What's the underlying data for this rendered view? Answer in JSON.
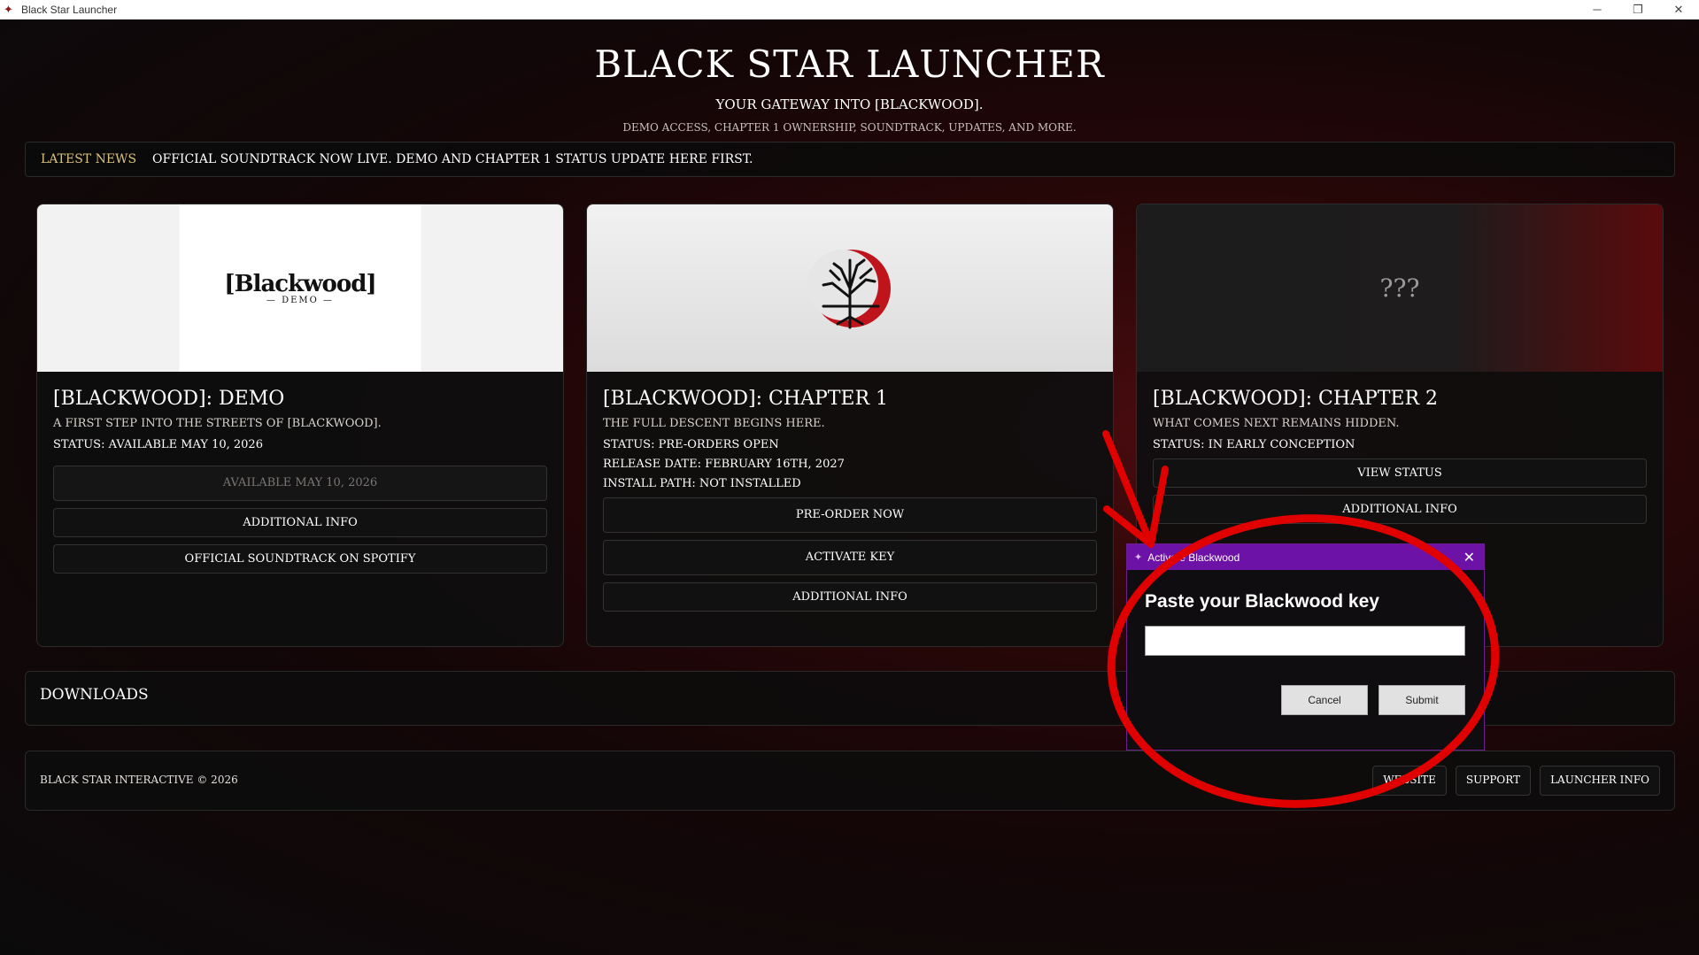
{
  "window": {
    "title": "Black Star Launcher"
  },
  "header": {
    "title": "Black Star Launcher",
    "tagline": "Your gateway into [Blackwood].",
    "subtitle": "Demo access, Chapter 1 ownership, soundtrack, updates, and more."
  },
  "news": {
    "label": "Latest News",
    "text": "Official soundtrack now live. Demo and Chapter 1 status update here first."
  },
  "cards": [
    {
      "logo_text": "[Blackwood]",
      "logo_sub": "DEMO",
      "title": "[Blackwood]: Demo",
      "description": "A first step into the streets of [Blackwood].",
      "meta": [
        "Status: Available May 10, 2026"
      ],
      "buttons": {
        "available": "Available May 10, 2026",
        "info": "Additional Info",
        "spotify": "Official Soundtrack on Spotify"
      }
    },
    {
      "title": "[Blackwood]: Chapter 1",
      "description": "The full descent begins here.",
      "meta": [
        "Status: Pre-orders open",
        "Release Date: February 16th, 2027",
        "Install Path: Not installed"
      ],
      "buttons": {
        "preorder": "Pre-order Now",
        "activate": "Activate Key",
        "info": "Additional Info"
      }
    },
    {
      "banner_text": "???",
      "title": "[Blackwood]: Chapter 2",
      "description": "What comes next remains hidden.",
      "meta": [
        "Status: In early conception"
      ],
      "buttons": {
        "status": "View Status",
        "info": "Additional Info"
      }
    }
  ],
  "downloads": {
    "title": "Downloads"
  },
  "footer": {
    "copyright": "Black Star Interactive © 2026",
    "links": [
      "Website",
      "Support",
      "Launcher Info"
    ]
  },
  "dialog": {
    "title": "Activate Blackwood",
    "prompt": "Paste your Blackwood key",
    "input_value": "",
    "cancel": "Cancel",
    "submit": "Submit"
  },
  "colors": {
    "accent_gold": "#d8c27a",
    "dialog_purple": "#6d12a7",
    "annotation_red": "#e00000"
  }
}
